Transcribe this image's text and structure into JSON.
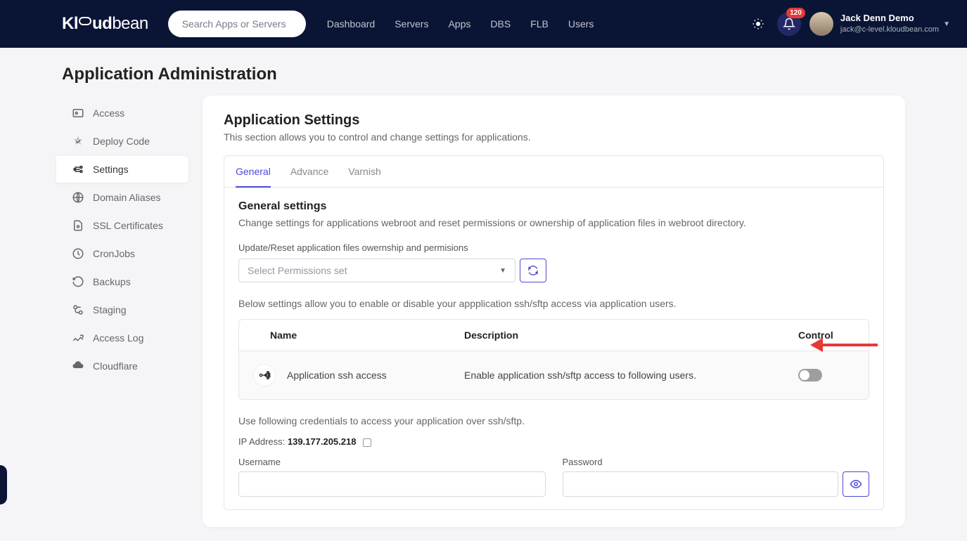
{
  "header": {
    "logo": "Kloudbean",
    "search_placeholder": "Search Apps or Servers",
    "nav": [
      "Dashboard",
      "Servers",
      "Apps",
      "DBS",
      "FLB",
      "Users"
    ],
    "badge": "120",
    "user_name": "Jack Denn Demo",
    "user_email": "jack@c-level.kloudbean.com"
  },
  "page_title": "Application Administration",
  "sidebar": [
    {
      "label": "Access"
    },
    {
      "label": "Deploy Code"
    },
    {
      "label": "Settings",
      "active": true
    },
    {
      "label": "Domain Aliases"
    },
    {
      "label": "SSL Certificates"
    },
    {
      "label": "CronJobs"
    },
    {
      "label": "Backups"
    },
    {
      "label": "Staging"
    },
    {
      "label": "Access Log"
    },
    {
      "label": "Cloudflare"
    }
  ],
  "main": {
    "title": "Application Settings",
    "subtitle": "This section allows you to control and change settings for applications.",
    "tabs": [
      "General",
      "Advance",
      "Varnish"
    ],
    "section_title": "General settings",
    "section_desc": "Change settings for applications webroot and reset permissions or ownership of application files in webroot directory.",
    "perm_label": "Update/Reset application files owernship and permisions",
    "perm_placeholder": "Select Permissions set",
    "ssh_note": "Below settings allow you to enable or disable your appplication ssh/sftp access via application users.",
    "table_headers": {
      "name": "Name",
      "desc": "Description",
      "ctrl": "Control"
    },
    "ssh_row": {
      "name": "Application ssh access",
      "desc": "Enable application ssh/sftp access to following users."
    },
    "cred_note": "Use following credentials to access your application over ssh/sftp.",
    "ip_label": "IP Address: ",
    "ip_value": "139.177.205.218",
    "username_label": "Username",
    "password_label": "Password"
  }
}
